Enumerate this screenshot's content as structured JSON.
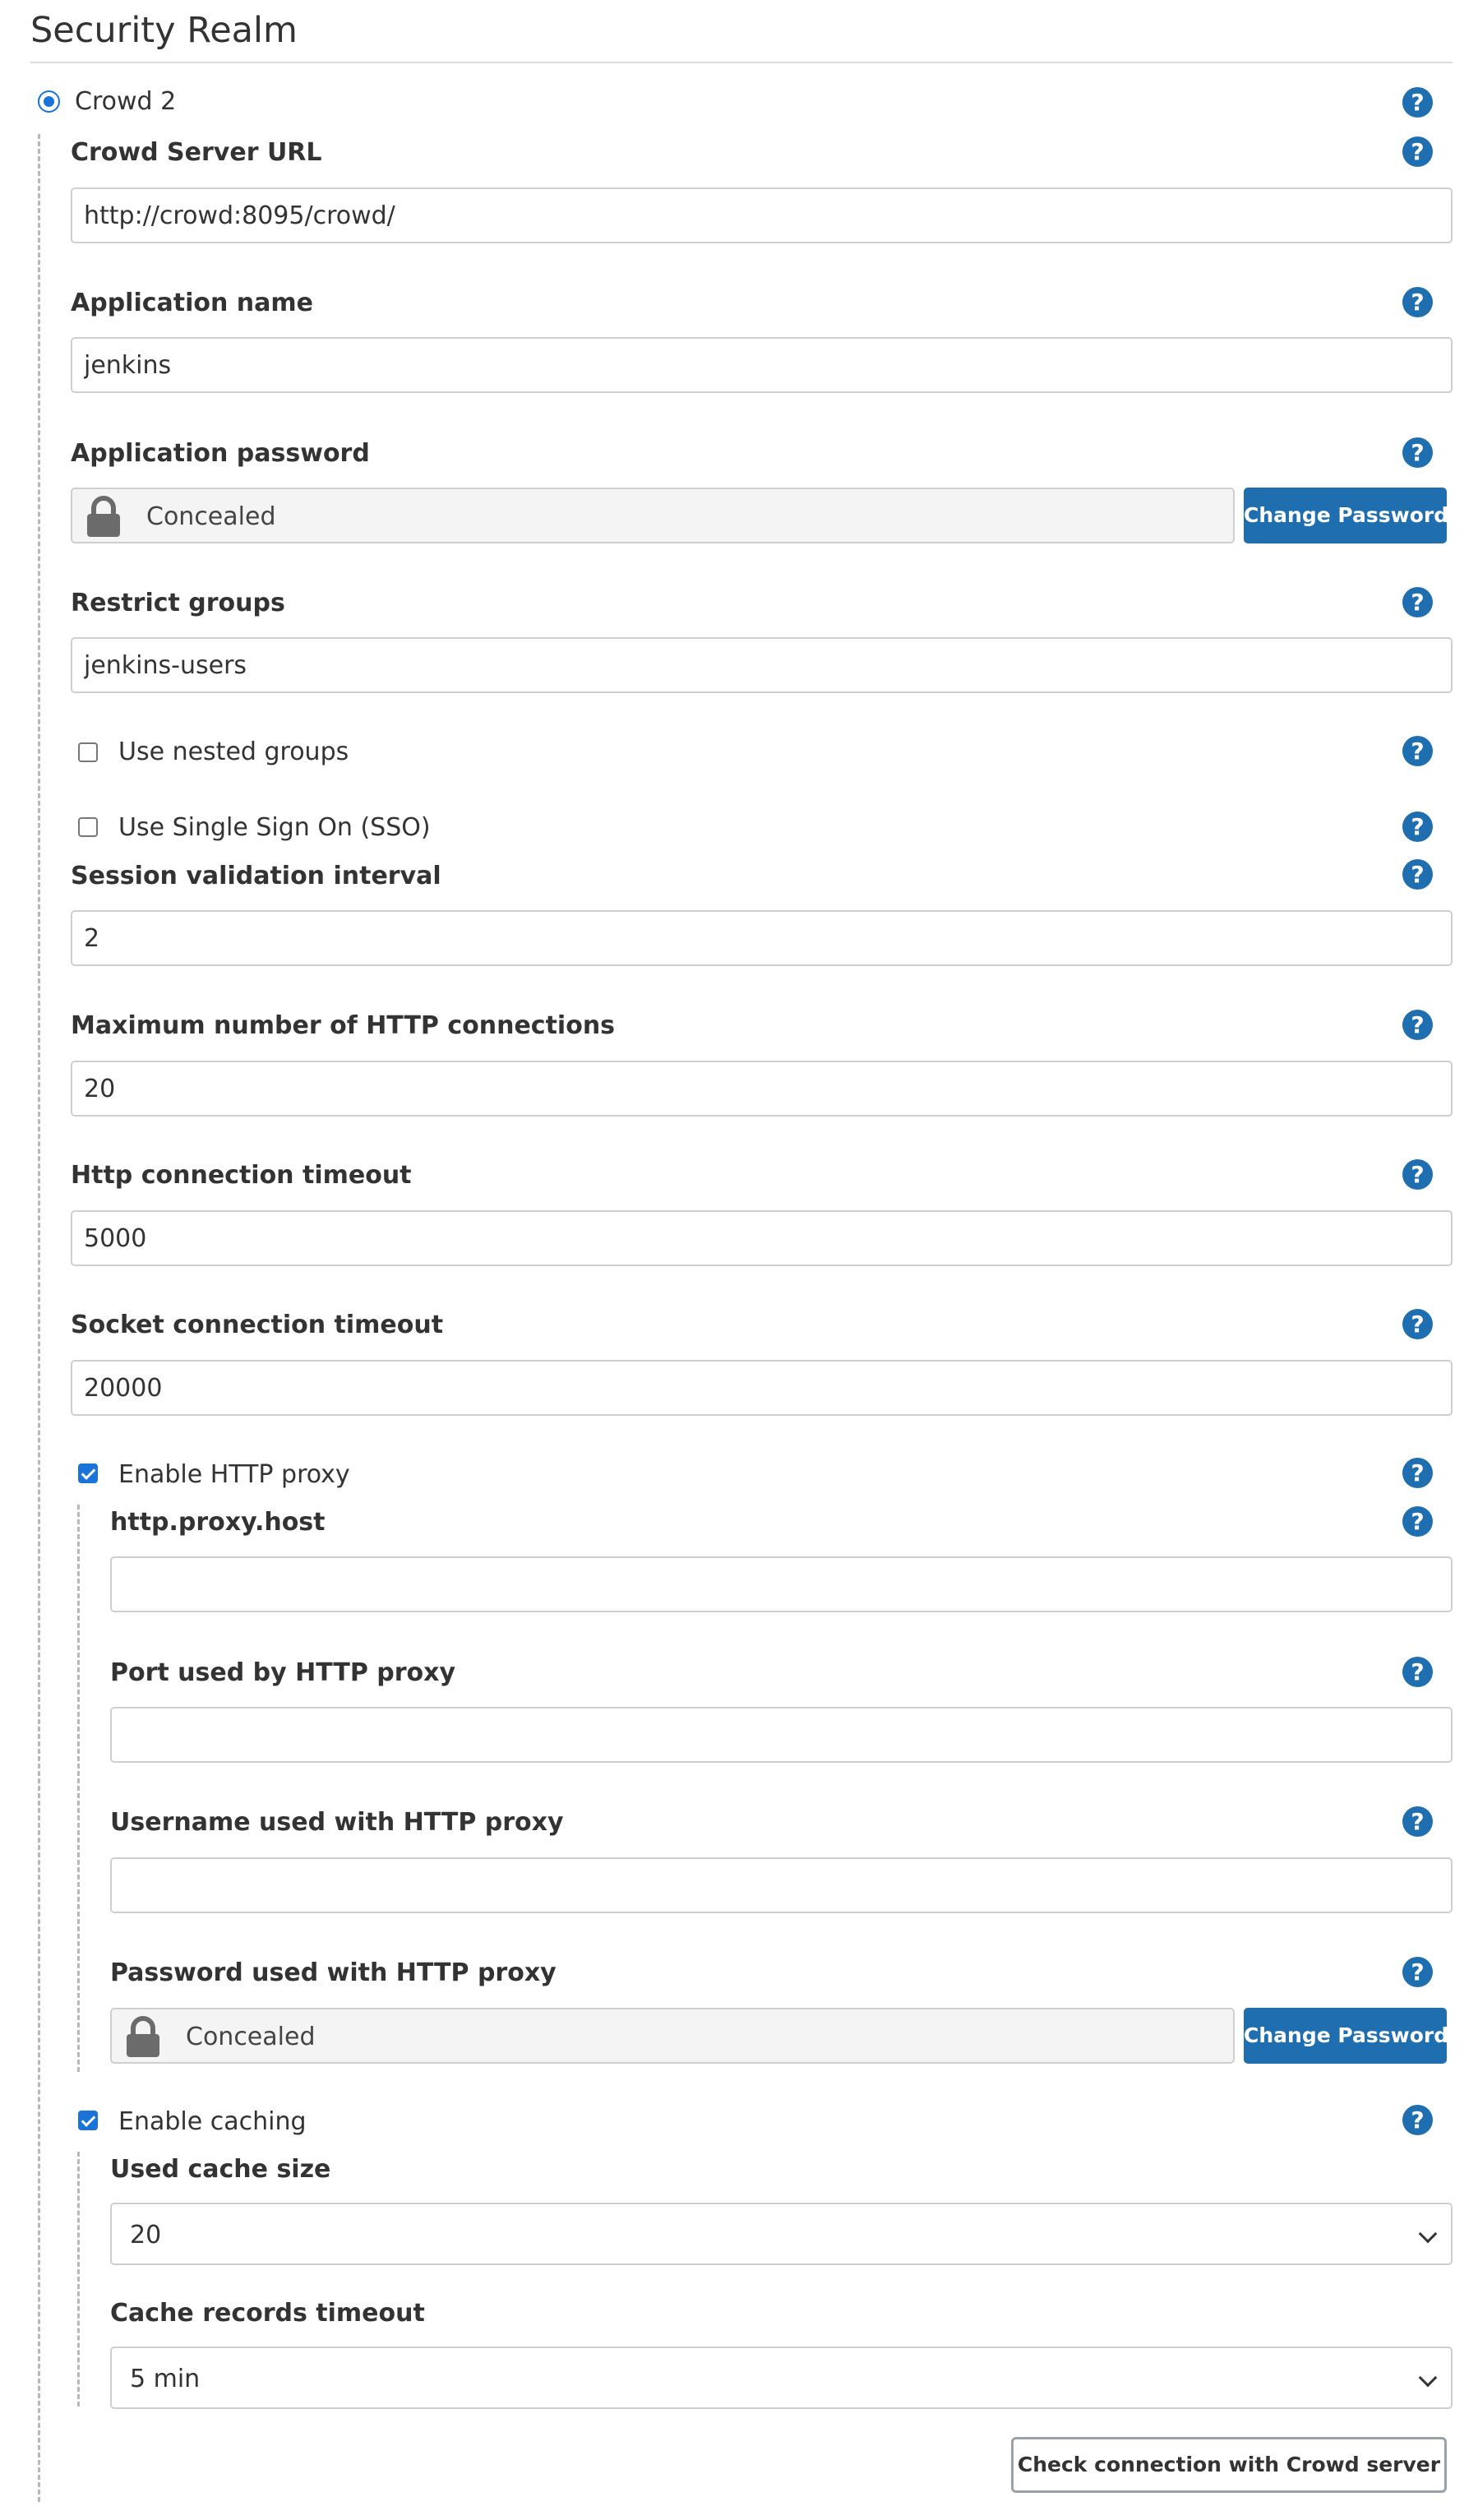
{
  "section": {
    "title": "Security Realm"
  },
  "realm": {
    "label": "Crowd 2",
    "selected": true
  },
  "help_glyph": "?",
  "fields": {
    "server_url": {
      "label": "Crowd Server URL",
      "value": "http://crowd:8095/crowd/"
    },
    "app_name": {
      "label": "Application name",
      "value": "jenkins"
    },
    "app_password": {
      "label": "Application password",
      "value": "Concealed",
      "button": "Change Password"
    },
    "restrict_groups": {
      "label": "Restrict groups",
      "value": "jenkins-users"
    },
    "nested_groups": {
      "label": "Use nested groups",
      "checked": false
    },
    "sso": {
      "label": "Use Single Sign On (SSO)",
      "checked": false
    },
    "session_interval": {
      "label": "Session validation interval",
      "value": "2"
    },
    "max_http": {
      "label": "Maximum number of HTTP connections",
      "value": "20"
    },
    "http_timeout": {
      "label": "Http connection timeout",
      "value": "5000"
    },
    "socket_timeout": {
      "label": "Socket connection timeout",
      "value": "20000"
    },
    "http_proxy": {
      "label": "Enable HTTP proxy",
      "checked": true
    },
    "proxy_host": {
      "label": "http.proxy.host",
      "value": ""
    },
    "proxy_port": {
      "label": "Port used by HTTP proxy",
      "value": ""
    },
    "proxy_username": {
      "label": "Username used with HTTP proxy",
      "value": ""
    },
    "proxy_password": {
      "label": "Password used with HTTP proxy",
      "value": "Concealed",
      "button": "Change Password"
    },
    "caching": {
      "label": "Enable caching",
      "checked": true
    },
    "cache_size": {
      "label": "Used cache size",
      "value": "20"
    },
    "cache_timeout": {
      "label": "Cache records timeout",
      "value": "5 min"
    }
  },
  "check_button": "Check connection with Crowd server",
  "colors": {
    "accent": "#1f6fb0",
    "radio": "#1a73d9",
    "border": "#cfcfcf"
  },
  "icons": [
    "help-icon",
    "lock-icon",
    "chevron-down-icon"
  ]
}
